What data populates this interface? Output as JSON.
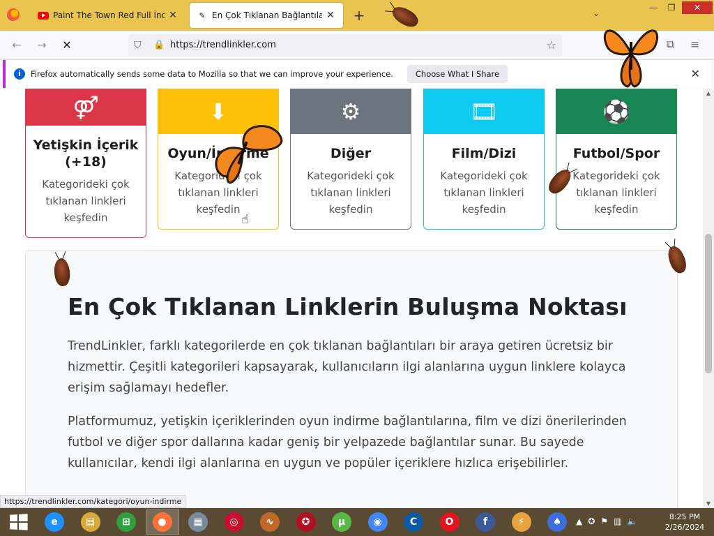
{
  "browser": {
    "tabs": [
      {
        "title": "Paint The Town Red Full İndirme",
        "active": false,
        "favicon": "youtube-icon"
      },
      {
        "title": "En Çok Tıklanan Bağlantılar - Tr",
        "active": true,
        "favicon": "site-icon"
      }
    ],
    "new_tab_label": "+",
    "url": "https://trendlinkler.com",
    "window_controls": {
      "minimize": "—",
      "maximize": "❐",
      "close": "✕"
    }
  },
  "notification": {
    "message": "Firefox automatically sends some data to Mozilla so that we can improve your experience.",
    "button": "Choose What I Share"
  },
  "categories": [
    {
      "icon": "gender-icon",
      "glyph": "⚤",
      "title": "Yetişkin İçerik (+18)",
      "desc": "Kategorideki çok tıklanan linkleri keşfedin",
      "color": "#dc3545"
    },
    {
      "icon": "download-icon",
      "glyph": "⬇",
      "title": "Oyun/İndirme",
      "desc": "Kategorideki çok tıklanan linkleri keşfedin",
      "color": "#ffc107"
    },
    {
      "icon": "tools-icon",
      "glyph": "⚙",
      "title": "Diğer",
      "desc": "Kategorideki çok tıklanan linkleri keşfedin",
      "color": "#6c757d"
    },
    {
      "icon": "film-icon",
      "glyph": "🎞",
      "title": "Film/Dizi",
      "desc": "Kategorideki çok tıklanan linkleri keşfedin",
      "color": "#0dcaf0"
    },
    {
      "icon": "soccer-ball-icon",
      "glyph": "⚽",
      "title": "Futbol/Spor",
      "desc": "Kategorideki çok tıklanan linkleri keşfedin",
      "color": "#198754"
    }
  ],
  "about": {
    "heading": "En Çok Tıklanan Linklerin Buluşma Noktası",
    "paragraph1": "TrendLinkler, farklı kategorilerde en çok tıklanan bağlantıları bir araya getiren ücretsiz bir hizmettir. Çeşitli kategorileri kapsayarak, kullanıcıların ilgi alanlarına uygun linklere kolayca erişim sağlamayı hedefler.",
    "paragraph2": "Platformumuz, yetişkin içeriklerinden oyun indirme bağlantılarına, film ve dizi önerilerinden futbol ve diğer spor dallarına kadar geniş bir yelpazede bağlantılar sunar. Bu sayede kullanıcılar, kendi ilgi alanlarına en uygun ve popüler içeriklere hızlıca erişebilirler."
  },
  "status_url": "https://trendlinkler.com/kategori/oyun-indirme",
  "taskbar": {
    "apps": [
      {
        "name": "internet-explorer-icon",
        "glyph": "e",
        "color": "#1e90ff"
      },
      {
        "name": "file-explorer-icon",
        "glyph": "▤",
        "color": "#d9a93a"
      },
      {
        "name": "store-icon",
        "glyph": "⊞",
        "color": "#2e9e3e"
      },
      {
        "name": "firefox-icon",
        "glyph": "●",
        "color": "#ff7139"
      },
      {
        "name": "task-manager-icon",
        "glyph": "▦",
        "color": "#7a8a9a"
      },
      {
        "name": "app-red-icon",
        "glyph": "◎",
        "color": "#c8102e"
      },
      {
        "name": "app-orange-swirl-icon",
        "glyph": "∿",
        "color": "#c0682a"
      },
      {
        "name": "app-red-star-icon",
        "glyph": "✪",
        "color": "#b01020"
      },
      {
        "name": "utorrent-icon",
        "glyph": "µ",
        "color": "#58b847"
      },
      {
        "name": "chrome-icon",
        "glyph": "◉",
        "color": "#4285f4"
      },
      {
        "name": "ccleaner-icon",
        "glyph": "C",
        "color": "#0a5aa8"
      },
      {
        "name": "opera-icon",
        "glyph": "O",
        "color": "#e0151e"
      },
      {
        "name": "facebook-icon",
        "glyph": "f",
        "color": "#3b5998"
      },
      {
        "name": "winamp-icon",
        "glyph": "⚡",
        "color": "#e8a33d"
      },
      {
        "name": "app-blue-icon",
        "glyph": "♠",
        "color": "#3a6ed8"
      }
    ],
    "time": "8:25 PM",
    "date": "2/26/2024"
  }
}
